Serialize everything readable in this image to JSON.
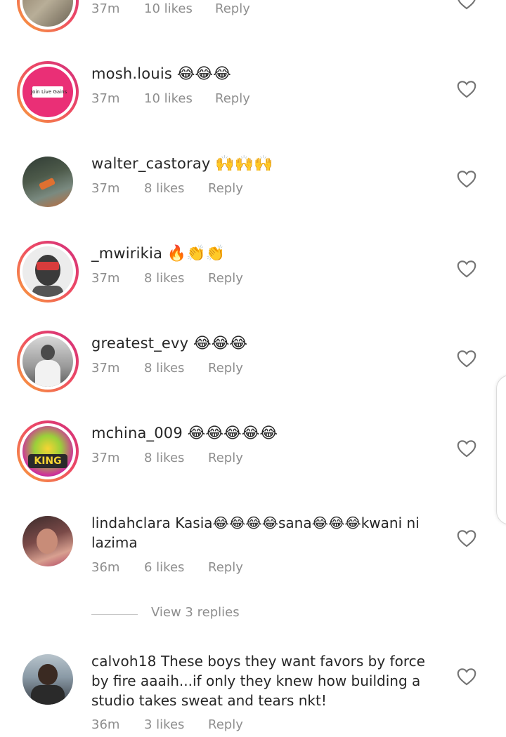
{
  "comments": [
    {
      "username": "",
      "text": "",
      "time": "37m",
      "likes": "10 likes",
      "reply": "Reply"
    },
    {
      "username": "mosh.louis",
      "emoji": "😂😂😂",
      "time": "37m",
      "likes": "10 likes",
      "reply": "Reply",
      "avatar_text": "Join Live Gains"
    },
    {
      "username": "walter_castoray",
      "emoji": "🙌🙌🙌",
      "time": "37m",
      "likes": "8 likes",
      "reply": "Reply"
    },
    {
      "username": "_mwirikia",
      "emoji": "🔥👏👏",
      "time": "37m",
      "likes": "8 likes",
      "reply": "Reply"
    },
    {
      "username": "greatest_evy",
      "emoji": "😂😂😂",
      "time": "37m",
      "likes": "8 likes",
      "reply": "Reply"
    },
    {
      "username": "mchina_009",
      "emoji": "😂😂😂😂😂",
      "time": "37m",
      "likes": "8 likes",
      "reply": "Reply",
      "avatar_text": "KING"
    },
    {
      "username": "lindahclara",
      "text": "Kasia😂😂😂😂sana😂😂😂kwani ni lazima",
      "time": "36m",
      "likes": "6 likes",
      "reply": "Reply"
    },
    {
      "username": "calvoh18",
      "text": "These boys they want favors by force by fire aaaih...if only they knew how building a studio takes sweat and tears nkt!",
      "time": "36m",
      "likes": "3 likes",
      "reply": "Reply"
    }
  ],
  "view_replies": "View 3 replies",
  "colors": {
    "text": "#262626",
    "meta": "#8e8e8e",
    "story_ring_start": "#f9a23a",
    "story_ring_end": "#d02d7e"
  },
  "icons": {
    "like": "heart-outline-icon"
  }
}
